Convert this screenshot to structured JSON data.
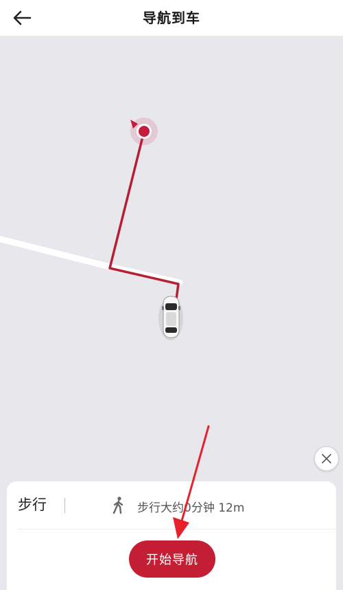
{
  "header": {
    "title": "导航到车",
    "back_icon": "arrow-left-icon"
  },
  "map": {
    "route_color": "#b61f34",
    "destination_color": "#c81d3a",
    "road_color": "#ffffff",
    "vehicle_icon": "car-icon"
  },
  "panel": {
    "mode_label": "步行",
    "walk_icon": "walking-person-icon",
    "estimate_text": "步行大约0分钟 12m",
    "close_icon": "close-icon",
    "start_button_label": "开始导航"
  },
  "colors": {
    "accent": "#c41e34",
    "map_background": "#e8e8ec"
  }
}
